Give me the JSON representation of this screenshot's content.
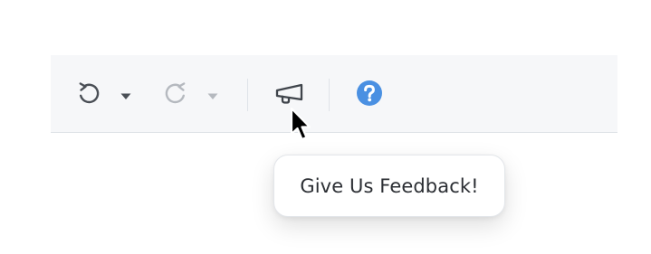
{
  "toolbar": {
    "buttons": [
      {
        "name": "undo",
        "icon": "undo-icon",
        "enabled": true
      },
      {
        "name": "undo-dropdown",
        "icon": "caret-down-icon",
        "enabled": true
      },
      {
        "name": "redo",
        "icon": "redo-icon",
        "enabled": false
      },
      {
        "name": "redo-dropdown",
        "icon": "caret-down-icon",
        "enabled": false
      },
      {
        "name": "feedback",
        "icon": "megaphone-icon",
        "enabled": true
      },
      {
        "name": "help",
        "icon": "help-icon",
        "enabled": true
      }
    ]
  },
  "tooltip": {
    "text": "Give Us Feedback!"
  },
  "colors": {
    "toolbar_bg": "#f6f7f9",
    "icon_active": "#4a4f56",
    "icon_disabled": "#b5b9bf",
    "help_blue": "#4a90e2"
  }
}
